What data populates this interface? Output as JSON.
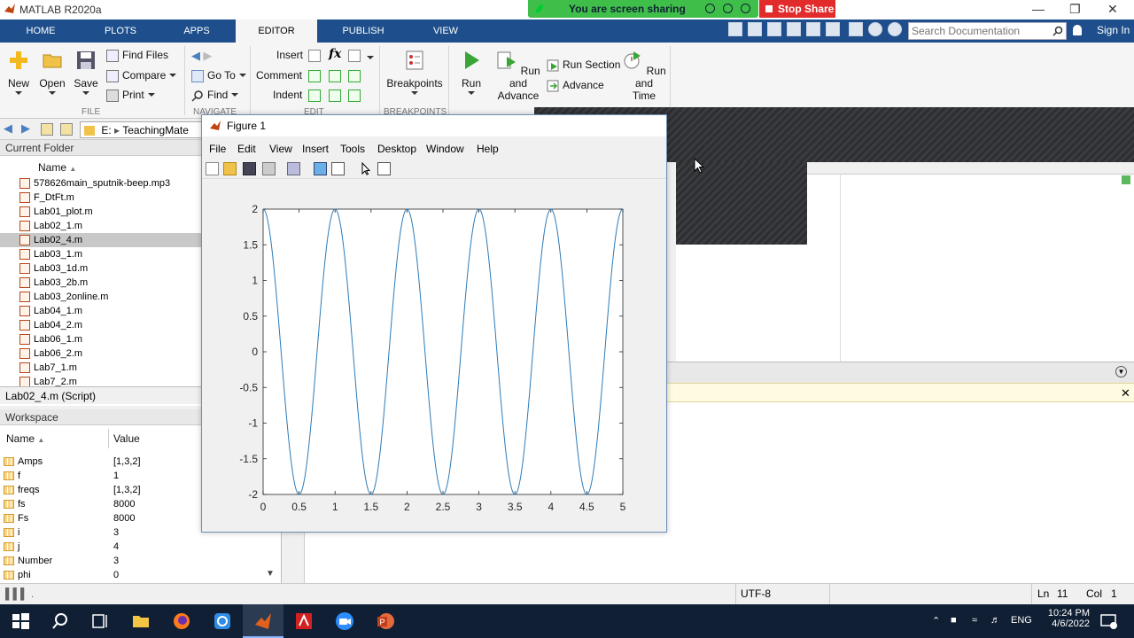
{
  "window": {
    "title": "MATLAB R2020a"
  },
  "screen_share": {
    "status": "You are screen sharing",
    "stop_label": "Stop Share"
  },
  "ribbon_tabs": [
    "HOME",
    "PLOTS",
    "APPS",
    "EDITOR",
    "PUBLISH",
    "VIEW"
  ],
  "active_tab": "EDITOR",
  "search": {
    "placeholder": "Search Documentation"
  },
  "sign_in": "Sign In",
  "ribbon": {
    "file": {
      "new": "New",
      "open": "Open",
      "save": "Save",
      "find_files": "Find Files",
      "compare": "Compare",
      "print": "Print",
      "group": "FILE"
    },
    "navigate": {
      "go_to": "Go To",
      "find": "Find",
      "group": "NAVIGATE"
    },
    "edit": {
      "insert": "Insert",
      "comment": "Comment",
      "indent": "Indent",
      "fx": "fx",
      "group": "EDIT"
    },
    "breakpoints": {
      "label": "Breakpoints",
      "group": "BREAKPOINTS"
    },
    "run": {
      "run": "Run",
      "run_and_advance_1": "Run and",
      "run_and_advance_2": "Advance",
      "run_section": "Run Section",
      "advance": "Advance",
      "run_and_time_1": "Run and",
      "run_and_time_2": "Time"
    }
  },
  "address": {
    "drive": "E:",
    "folder": "TeachingMate"
  },
  "current_folder": {
    "title": "Current Folder",
    "name_header": "Name",
    "files": [
      "578626main_sputnik-beep.mp3",
      "F_DtFt.m",
      "Lab01_plot.m",
      "Lab02_1.m",
      "Lab02_4.m",
      "Lab03_1.m",
      "Lab03_1d.m",
      "Lab03_2b.m",
      "Lab03_2online.m",
      "Lab04_1.m",
      "Lab04_2.m",
      "Lab06_1.m",
      "Lab06_2.m",
      "Lab7_1.m",
      "Lab7_2.m"
    ],
    "selected": "Lab02_4.m"
  },
  "script_label": "Lab02_4.m  (Script)",
  "workspace": {
    "title": "Workspace",
    "headers": {
      "name": "Name",
      "value": "Value"
    },
    "rows": [
      {
        "name": "Amps",
        "value": "[1,3,2]"
      },
      {
        "name": "f",
        "value": "1"
      },
      {
        "name": "freqs",
        "value": "[1,3,2]"
      },
      {
        "name": "fs",
        "value": "8000"
      },
      {
        "name": "Fs",
        "value": "8000"
      },
      {
        "name": "i",
        "value": "3"
      },
      {
        "name": "j",
        "value": "4"
      },
      {
        "name": "Number",
        "value": "3"
      },
      {
        "name": "phi",
        "value": "0"
      }
    ]
  },
  "figure": {
    "title": "Figure 1",
    "menu": [
      "File",
      "Edit",
      "View",
      "Insert",
      "Tools",
      "Desktop",
      "Window",
      "Help"
    ]
  },
  "chart_data": {
    "type": "line",
    "function": "2*cos(2*pi*x)",
    "amplitude": 2,
    "frequency": 1,
    "xlim": [
      0,
      5
    ],
    "ylim": [
      -2,
      2
    ],
    "xticks": [
      "0",
      "0.5",
      "1",
      "1.5",
      "2",
      "2.5",
      "3",
      "3.5",
      "4",
      "4.5",
      "5"
    ],
    "yticks": [
      "2",
      "1.5",
      "1",
      "0.5",
      "0",
      "-0.5",
      "-1",
      "-1.5",
      "-2"
    ],
    "line_color": "#2b7bb9",
    "grid": false
  },
  "statusbar": {
    "encoding": "UTF-8",
    "ln_label": "Ln",
    "ln": "11",
    "col_label": "Col",
    "col": "1"
  },
  "taskbar": {
    "time": "10:24 PM",
    "date": "4/6/2022",
    "lang": "ENG"
  },
  "colors": {
    "ribbon_blue": "#1e4f8c",
    "share_green": "#3fbf4a",
    "stop_red": "#e22b2b"
  }
}
